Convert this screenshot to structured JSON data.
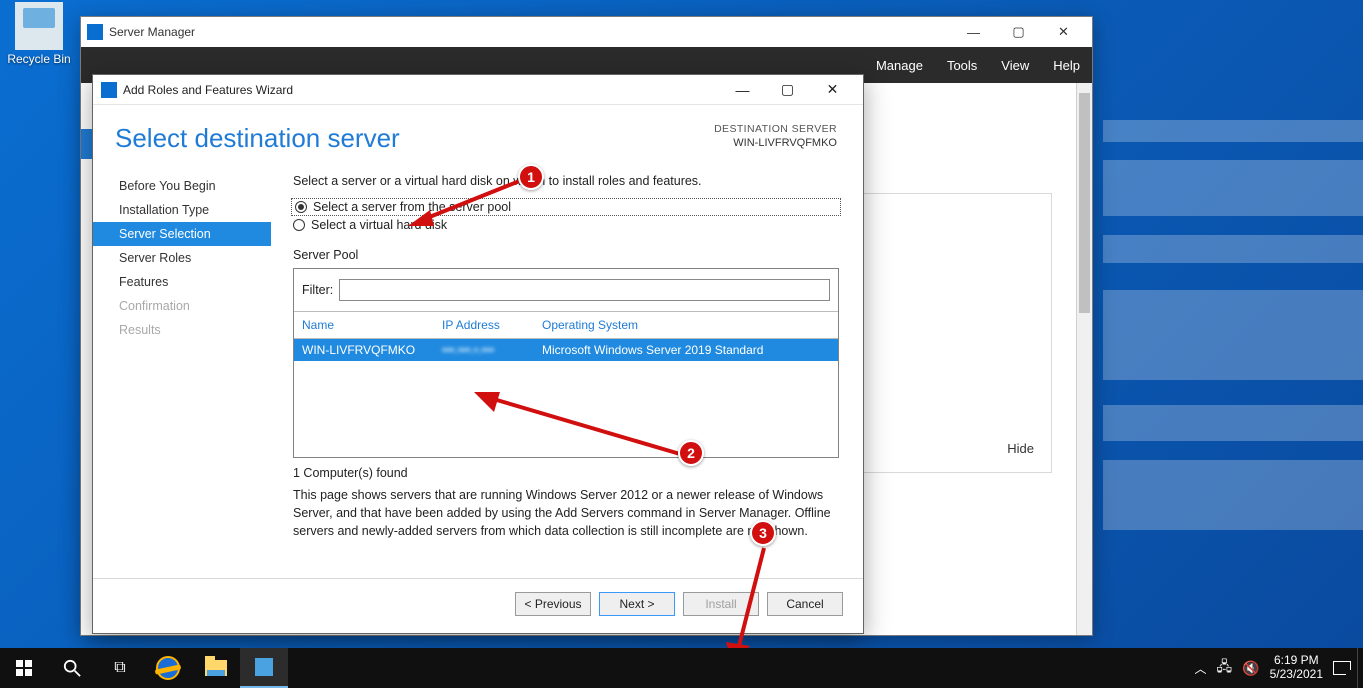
{
  "desktop": {
    "recycle_bin": "Recycle Bin"
  },
  "server_manager": {
    "title": "Server Manager",
    "menu": {
      "manage": "Manage",
      "tools": "Tools",
      "view": "View",
      "help": "Help"
    },
    "hide": "Hide"
  },
  "wizard": {
    "title": "Add Roles and Features Wizard",
    "heading": "Select destination server",
    "dest_label": "DESTINATION SERVER",
    "dest_server": "WIN-LIVFRVQFMKO",
    "nav": {
      "before": "Before You Begin",
      "install_type": "Installation Type",
      "server_selection": "Server Selection",
      "server_roles": "Server Roles",
      "features": "Features",
      "confirmation": "Confirmation",
      "results": "Results"
    },
    "intro": "Select a server or a virtual hard disk on which to install roles and features.",
    "radio_pool": "Select a server from the server pool",
    "radio_vhd": "Select a virtual hard disk",
    "section": "Server Pool",
    "filter_label": "Filter:",
    "filter_value": "",
    "columns": {
      "name": "Name",
      "ip": "IP Address",
      "os": "Operating System"
    },
    "rows": [
      {
        "name": "WIN-LIVFRVQFMKO",
        "ip": "•••.•••.•.•••",
        "os": "Microsoft Windows Server 2019 Standard"
      }
    ],
    "found": "1 Computer(s) found",
    "note": "This page shows servers that are running Windows Server 2012 or a newer release of Windows Server, and that have been added by using the Add Servers command in Server Manager. Offline servers and newly-added servers from which data collection is still incomplete are not shown.",
    "buttons": {
      "previous": "< Previous",
      "next": "Next >",
      "install": "Install",
      "cancel": "Cancel"
    }
  },
  "annotations": {
    "c1": "1",
    "c2": "2",
    "c3": "3"
  },
  "taskbar": {
    "time": "6:19 PM",
    "date": "5/23/2021"
  }
}
